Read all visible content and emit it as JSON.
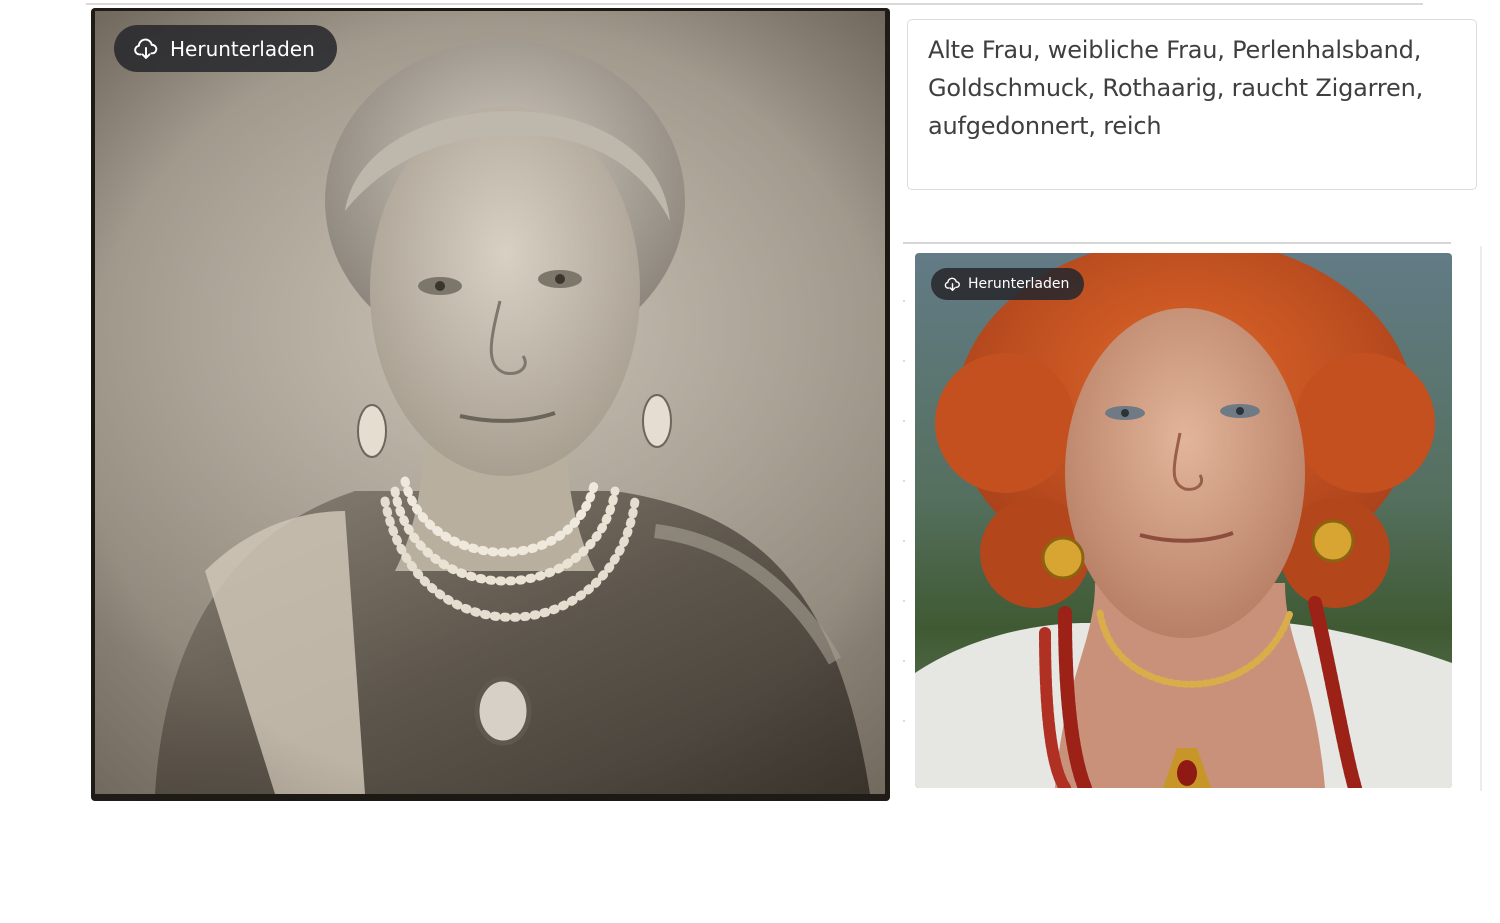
{
  "results": [
    {
      "image_alt": "Sepia portrait of an elderly woman with grey hair, pearl necklaces and drop earrings",
      "download_label": "Herunterladen",
      "download_icon": "cloud-download-icon"
    },
    {
      "image_alt": "Color portrait of an elderly woman with curly red hair, gold earrings and red bead necklaces",
      "download_label": "Herunterladen",
      "download_icon": "cloud-download-icon"
    }
  ],
  "prompt": {
    "text": "Alte Frau, weibliche Frau, Perlenhalsband, Goldschmuck, Rothaarig, raucht Zigarren, aufgedonnert, reich"
  }
}
